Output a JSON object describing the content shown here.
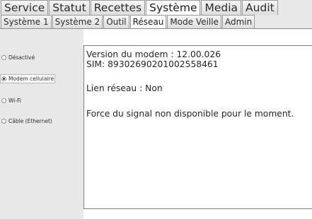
{
  "main_tabs": [
    {
      "label": "Service"
    },
    {
      "label": "Statut"
    },
    {
      "label": "Recettes"
    },
    {
      "label": "Système"
    },
    {
      "label": "Media"
    },
    {
      "label": "Audit"
    }
  ],
  "main_tabs_active": "Système",
  "sub_tabs": [
    {
      "label": "Système 1"
    },
    {
      "label": "Système 2"
    },
    {
      "label": "Outil"
    },
    {
      "label": "Réseau"
    },
    {
      "label": "Mode Veille"
    },
    {
      "label": "Admin"
    }
  ],
  "sub_tabs_active": "Réseau",
  "network_options": [
    {
      "label": "Désactivé",
      "selected": false
    },
    {
      "label": "Modem cellulaire",
      "selected": true
    },
    {
      "label": "Wi-Fi",
      "selected": false
    },
    {
      "label": "Câble (Ethernet)",
      "selected": false
    }
  ],
  "status": {
    "modem_version": "Version du modem : 12.00.026",
    "sim": "SIM: 89302690201002558461",
    "link": "Lien réseau : Non",
    "signal": "Force du signal non disponible pour le moment."
  }
}
